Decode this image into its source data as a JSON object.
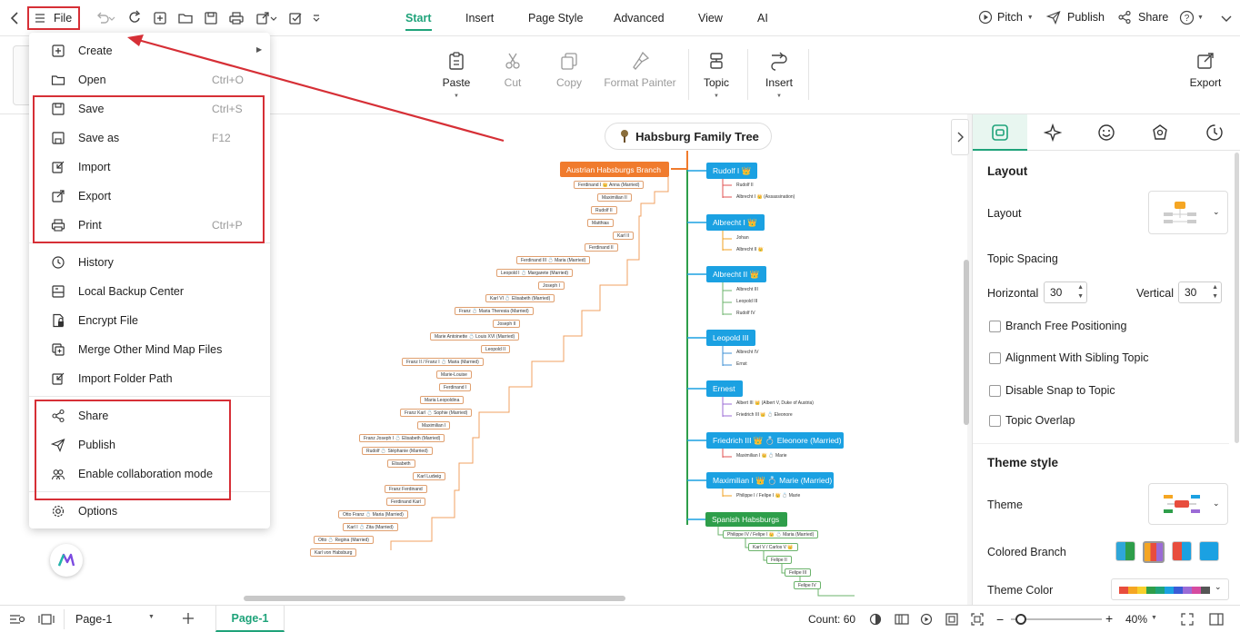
{
  "topbar": {
    "file_label": "File",
    "tabs": [
      "Start",
      "Insert",
      "Page Style",
      "Advanced",
      "View",
      "AI"
    ],
    "active_tab": "Start",
    "pitch_label": "Pitch",
    "publish_label": "Publish",
    "share_label": "Share"
  },
  "ribbon": {
    "paste": "Paste",
    "cut": "Cut",
    "copy": "Copy",
    "format_painter": "Format Painter",
    "topic": "Topic",
    "insert": "Insert",
    "export": "Export"
  },
  "file_menu": {
    "items": [
      {
        "label": "Create",
        "shortcut": "",
        "icon": "plus-square-icon"
      },
      {
        "label": "Open",
        "shortcut": "Ctrl+O",
        "icon": "folder-icon"
      },
      {
        "label": "Save",
        "shortcut": "Ctrl+S",
        "icon": "save-icon"
      },
      {
        "label": "Save as",
        "shortcut": "F12",
        "icon": "save-as-icon"
      },
      {
        "label": "Import",
        "shortcut": "",
        "icon": "import-icon"
      },
      {
        "label": "Export",
        "shortcut": "",
        "icon": "export-icon"
      },
      {
        "label": "Print",
        "shortcut": "Ctrl+P",
        "icon": "print-icon"
      },
      {
        "label": "History",
        "shortcut": "",
        "icon": "history-icon"
      },
      {
        "label": "Local Backup Center",
        "shortcut": "",
        "icon": "backup-icon"
      },
      {
        "label": "Encrypt File",
        "shortcut": "",
        "icon": "lock-file-icon"
      },
      {
        "label": "Merge Other Mind Map Files",
        "shortcut": "",
        "icon": "merge-icon"
      },
      {
        "label": "Import Folder Path",
        "shortcut": "",
        "icon": "folder-import-icon"
      },
      {
        "label": "Share",
        "shortcut": "",
        "icon": "share-icon"
      },
      {
        "label": "Publish",
        "shortcut": "",
        "icon": "publish-icon"
      },
      {
        "label": "Enable collaboration mode",
        "shortcut": "",
        "icon": "collaboration-icon"
      },
      {
        "label": "Options",
        "shortcut": "",
        "icon": "gear-icon"
      }
    ]
  },
  "canvas": {
    "root_title": "Habsburg Family Tree",
    "left_branch": "Austrian Habsburgs Branch",
    "left_leaves": [
      "Ferdinand I 👑 Anna (Married)",
      "Maximilian II",
      "Rudolf II",
      "Matthias",
      "Karl II",
      "Ferdinand II",
      "Ferdinand III 💍 Maria (Married)",
      "Leopold I 💍 Margarete (Married)",
      "Joseph I",
      "Karl VI 💍 Elisabeth (Married)",
      "Franz 💍 Maria Theresia (Married)",
      "Joseph II",
      "Marie Antoinette 💍 Louis XVI (Married)",
      "Leopold II",
      "Franz II / Franz I 💍 Maria (Married)",
      "Marie-Louise",
      "Ferdinand I",
      "Maria Leopoldina",
      "Franz Karl 💍 Sophie (Married)",
      "Maximilian I",
      "Franz Joseph I 💍 Elisabeth (Married)",
      "Rudolf 💍 Stéphanie (Married)",
      "Elisabeth",
      "Karl Ludwig",
      "Franz Ferdinand",
      "Ferdinand Karl",
      "Otto Franz 💍 Maria (Married)",
      "Karl I 💍 Zita (Married)",
      "Otto 💍 Regina (Married)",
      "Karl von Habsburg"
    ],
    "right_branches": [
      {
        "label": "Rudolf I 👑",
        "children": [
          "Rudolf II",
          "Albrecht I 👑 (Assassination)"
        ]
      },
      {
        "label": "Albrecht I 👑",
        "children": [
          "Johan",
          "Albrecht II 👑"
        ]
      },
      {
        "label": "Albrecht II 👑",
        "children": [
          "Albrecht III",
          "Leopold III",
          "Rudolf IV"
        ]
      },
      {
        "label": "Leopold III",
        "children": [
          "Albrecht IV",
          "Ernst"
        ]
      },
      {
        "label": "Ernest",
        "children": [
          "Albert III 👑 (Albert V, Duke of Austria)",
          "Friedrich III 👑 💍 Eleonore"
        ]
      },
      {
        "label": "Friedrich III 👑 💍 Eleonore (Married)",
        "children": [
          "Maximilian I 👑 💍 Marie"
        ]
      },
      {
        "label": "Maximilian I 👑 💍 Marie (Married)",
        "children": [
          "Philippe I / Felipe I 👑 💍 Marie"
        ]
      }
    ],
    "spanish_branch": "Spanish Habsburgs",
    "spanish_leaves": [
      "Philippe IV / Felipe I 👑 💍 Maria (Married)",
      "Karl V / Carlos V 👑",
      "Felipe II",
      "Felipe III",
      "Felipe IV"
    ]
  },
  "right_panel": {
    "layout_heading": "Layout",
    "layout_label": "Layout",
    "topic_spacing_label": "Topic Spacing",
    "horizontal_label": "Horizontal",
    "horizontal_value": "30",
    "vertical_label": "Vertical",
    "vertical_value": "30",
    "checkboxes": [
      "Branch Free Positioning",
      "Alignment With Sibling Topic",
      "Disable Snap to Topic",
      "Topic Overlap"
    ],
    "theme_style_heading": "Theme style",
    "theme_label": "Theme",
    "colored_branch_label": "Colored Branch",
    "theme_color_label": "Theme Color"
  },
  "statusbar": {
    "page_select": "Page-1",
    "page_tab": "Page-1",
    "count": "Count: 60",
    "zoom": "40%"
  },
  "colors": {
    "accent": "#1fa37a",
    "branch_orange": "#f07b2d",
    "branch_blue": "#1ba1e2",
    "branch_green": "#2e9e4a",
    "highlight_red": "#d62f36"
  }
}
